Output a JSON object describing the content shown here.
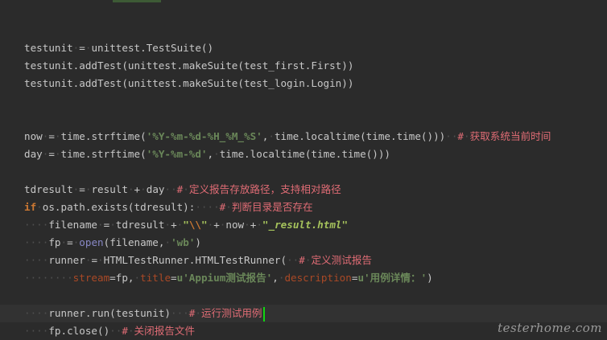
{
  "watermark": "testerhome.com",
  "lines": [
    {
      "blank": true
    },
    [
      [
        "id",
        "testunit"
      ],
      [
        "ws",
        "·"
      ],
      [
        "p",
        "="
      ],
      [
        "ws",
        "·"
      ],
      [
        "id",
        "unittest.TestSuite()"
      ]
    ],
    [
      [
        "id",
        "testunit.addTest(unittest.makeSuite(test_first.First))"
      ]
    ],
    [
      [
        "id",
        "testunit.addTest(unittest.makeSuite(test_login.Login))"
      ]
    ],
    {
      "blank": true
    },
    {
      "blank": true
    },
    [
      [
        "id",
        "now"
      ],
      [
        "ws",
        "·"
      ],
      [
        "p",
        "="
      ],
      [
        "ws",
        "·"
      ],
      [
        "id",
        "time.strftime("
      ],
      [
        "str",
        "'%Y-%m-%d-%H_%M_%S'"
      ],
      [
        "p",
        ","
      ],
      [
        "ws",
        "·"
      ],
      [
        "id",
        "time.localtime(time.time()))"
      ],
      [
        "ws",
        "··"
      ],
      [
        "cmt",
        "#"
      ],
      [
        "ws",
        "·"
      ],
      [
        "cmt",
        "获取系统当前时间"
      ]
    ],
    [
      [
        "id",
        "day"
      ],
      [
        "ws",
        "·"
      ],
      [
        "p",
        "="
      ],
      [
        "ws",
        "·"
      ],
      [
        "id",
        "time.strftime("
      ],
      [
        "str",
        "'%Y-%m-%d'"
      ],
      [
        "p",
        ","
      ],
      [
        "ws",
        "·"
      ],
      [
        "id",
        "time.localtime(time.time()))"
      ]
    ],
    {
      "blank": true
    },
    [
      [
        "id",
        "tdresult"
      ],
      [
        "ws",
        "·"
      ],
      [
        "p",
        "="
      ],
      [
        "ws",
        "·"
      ],
      [
        "id",
        "result"
      ],
      [
        "ws",
        "·"
      ],
      [
        "p",
        "+"
      ],
      [
        "ws",
        "·"
      ],
      [
        "id",
        "day"
      ],
      [
        "ws",
        "··"
      ],
      [
        "cmt",
        "#"
      ],
      [
        "ws",
        "·"
      ],
      [
        "cmt",
        "定义报告存放路径，支持相对路径"
      ]
    ],
    [
      [
        "kw",
        "if"
      ],
      [
        "ws",
        "·"
      ],
      [
        "id",
        "os.path.exists(tdresult):"
      ],
      [
        "ws",
        "····"
      ],
      [
        "cmt",
        "#"
      ],
      [
        "ws",
        "·"
      ],
      [
        "cmt",
        "判断目录是否存在"
      ]
    ],
    [
      [
        "ws",
        "····"
      ],
      [
        "id",
        "filename"
      ],
      [
        "ws",
        "·"
      ],
      [
        "p",
        "="
      ],
      [
        "ws",
        "·"
      ],
      [
        "id",
        "tdresult"
      ],
      [
        "ws",
        "·"
      ],
      [
        "p",
        "+"
      ],
      [
        "ws",
        "·"
      ],
      [
        "strb",
        "\""
      ],
      [
        "esc",
        "\\\\"
      ],
      [
        "strb",
        "\""
      ],
      [
        "ws",
        "·"
      ],
      [
        "p",
        "+"
      ],
      [
        "ws",
        "·"
      ],
      [
        "id",
        "now"
      ],
      [
        "ws",
        "·"
      ],
      [
        "p",
        "+"
      ],
      [
        "ws",
        "·"
      ],
      [
        "strb",
        "\"_result.html\""
      ]
    ],
    [
      [
        "ws",
        "····"
      ],
      [
        "id",
        "fp"
      ],
      [
        "ws",
        "·"
      ],
      [
        "p",
        "="
      ],
      [
        "ws",
        "·"
      ],
      [
        "bi",
        "open"
      ],
      [
        "id",
        "(filename,"
      ],
      [
        "ws",
        "·"
      ],
      [
        "str",
        "'wb'"
      ],
      [
        "id",
        ")"
      ]
    ],
    [
      [
        "ws",
        "····"
      ],
      [
        "id",
        "runner"
      ],
      [
        "ws",
        "·"
      ],
      [
        "p",
        "="
      ],
      [
        "ws",
        "·"
      ],
      [
        "id",
        "HTMLTestRunner.HTMLTestRunner("
      ],
      [
        "ws",
        "··"
      ],
      [
        "cmt",
        "#"
      ],
      [
        "ws",
        "·"
      ],
      [
        "cmt",
        "定义测试报告"
      ]
    ],
    [
      [
        "ws",
        "········"
      ],
      [
        "kwarg",
        "stream"
      ],
      [
        "p",
        "=fp,"
      ],
      [
        "ws",
        "·"
      ],
      [
        "kwarg",
        "title"
      ],
      [
        "p",
        "="
      ],
      [
        "str",
        "u'Appium测试报告'"
      ],
      [
        "p",
        ","
      ],
      [
        "ws",
        "·"
      ],
      [
        "kwarg",
        "description"
      ],
      [
        "p",
        "="
      ],
      [
        "str",
        "u'用例详情：'"
      ],
      [
        "id",
        ")"
      ]
    ],
    {
      "blank": true
    },
    {
      "current": true,
      "caretAfter": true,
      "tokens": [
        [
          "ws",
          "····"
        ],
        [
          "id",
          "runner.run(testunit)"
        ],
        [
          "ws",
          "···"
        ],
        [
          "cmt",
          "#"
        ],
        [
          "ws",
          "·"
        ],
        [
          "cmt",
          "运行测试用例"
        ]
      ]
    },
    [
      [
        "ws",
        "····"
      ],
      [
        "id",
        "fp.close()"
      ],
      [
        "ws",
        "··"
      ],
      [
        "cmt",
        "#"
      ],
      [
        "ws",
        "·"
      ],
      [
        "cmt",
        "关闭报告文件"
      ]
    ]
  ]
}
